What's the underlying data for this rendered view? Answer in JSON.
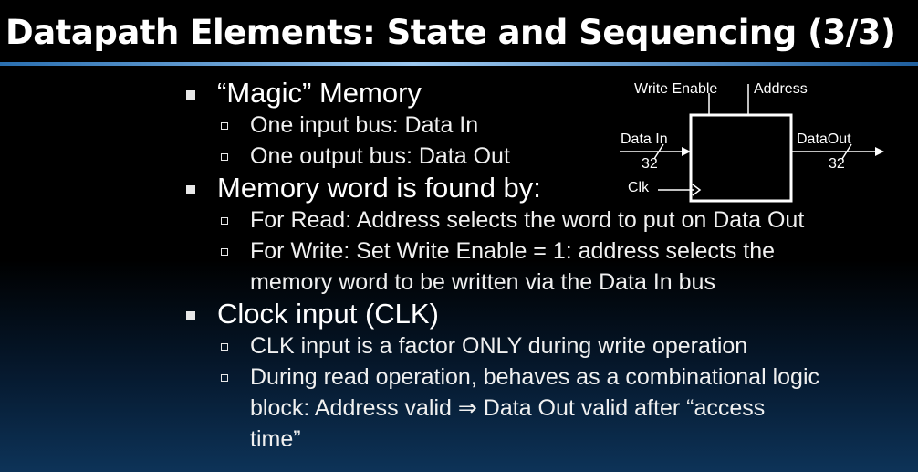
{
  "slide": {
    "title": "Datapath Elements: State and Sequencing (3/3)"
  },
  "bullets": [
    {
      "text": "“Magic” Memory",
      "sub": [
        "One input bus: Data In",
        "One output bus: Data Out"
      ]
    },
    {
      "text": "Memory word is found by:",
      "sub": [
        "For Read: Address selects the word to put on Data Out",
        "For Write: Set Write Enable = 1: address selects the",
        "memory word to be written via the Data In bus"
      ]
    },
    {
      "text": "Clock input (CLK)",
      "sub": [
        "CLK input is a factor ONLY during write operation",
        "During read operation, behaves as a combinational logic",
        "block: Address valid ⇒ Data Out valid after “access",
        "time”"
      ]
    }
  ],
  "diagram": {
    "write_enable": "Write Enable",
    "address": "Address",
    "data_in": "Data In",
    "data_in_width": "32",
    "data_out": "DataOut",
    "data_out_width": "32",
    "clk": "Clk"
  }
}
